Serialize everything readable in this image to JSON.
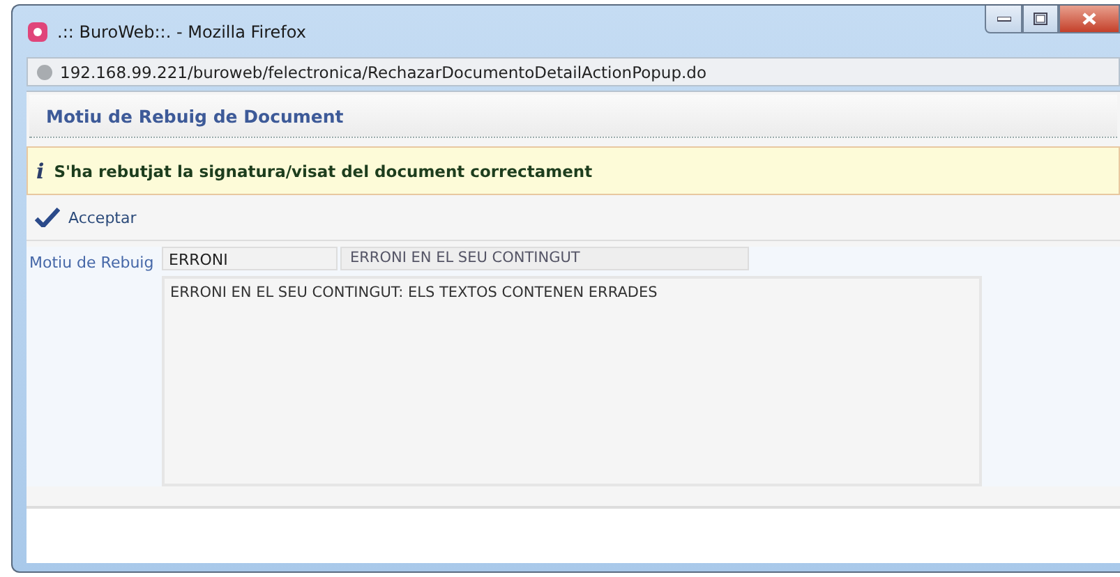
{
  "window": {
    "title": ".:: BuroWeb::. - Mozilla Firefox"
  },
  "address_bar": {
    "url": "192.168.99.221/buroweb/felectronica/RechazarDocumentoDetailActionPopup.do"
  },
  "panel": {
    "title": "Motiu de Rebuig de Document"
  },
  "message": {
    "icon": "i",
    "text": "S'ha rebutjat la signatura/visat del document correctament"
  },
  "toolbar": {
    "buttons": [
      {
        "label": "Acceptar"
      }
    ]
  },
  "form": {
    "label": "Motiu de Rebuig",
    "code": "ERRONI",
    "description": "ERRONI EN EL SEU CONTINGUT",
    "comment": "ERRONI EN EL SEU CONTINGUT: ELS TEXTOS CONTENEN ERRADES"
  }
}
